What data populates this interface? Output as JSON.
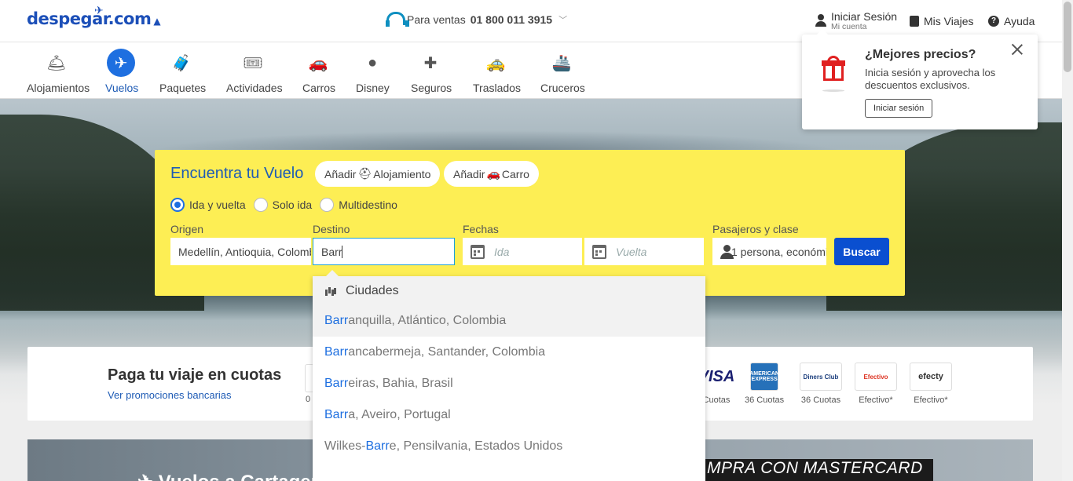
{
  "header": {
    "logo": "despegar.com",
    "sales_label": "Para ventas",
    "sales_phone": "01 800 011 3915",
    "login_main": "Iniciar Sesión",
    "login_sub": "Mi cuenta",
    "my_trips": "Mis Viajes",
    "help": "Ayuda"
  },
  "nav": {
    "items": [
      {
        "label": "Alojamientos",
        "icon": "hotel-bell-icon"
      },
      {
        "label": "Vuelos",
        "icon": "plane-icon",
        "active": true
      },
      {
        "label": "Paquetes",
        "icon": "suitcase-icon"
      },
      {
        "label": "Actividades",
        "icon": "tickets-icon"
      },
      {
        "label": "Carros",
        "icon": "car-icon"
      },
      {
        "label": "Disney",
        "icon": "mickey-icon"
      },
      {
        "label": "Seguros",
        "icon": "medkit-icon"
      },
      {
        "label": "Traslados",
        "icon": "taxi-icon"
      },
      {
        "label": "Cruceros",
        "icon": "ship-icon"
      }
    ]
  },
  "search": {
    "title": "Encuentra tu Vuelo",
    "add_lodging_pre": "Añadir",
    "add_lodging": "Alojamiento",
    "add_car_pre": "Añadir",
    "add_car": "Carro",
    "trip_types": [
      "Ida y vuelta",
      "Solo ida",
      "Multidestino"
    ],
    "selected_trip_type": "Ida y vuelta",
    "origin_label": "Origen",
    "origin_value": "Medellín, Antioquia, Colombia",
    "dest_label": "Destino",
    "dest_value": "Barr",
    "dates_label": "Fechas",
    "depart_placeholder": "Ida",
    "return_placeholder": "Vuelta",
    "pax_label": "Pasajeros y clase",
    "pax_value": "1 persona, económica",
    "search_button": "Buscar"
  },
  "autocomplete": {
    "group": "Ciudades",
    "items": [
      {
        "pre": "",
        "match": "Barr",
        "rest": "anquilla, Atlántico, Colombia"
      },
      {
        "pre": "",
        "match": "Barr",
        "rest": "ancabermeja, Santander, Colombia"
      },
      {
        "pre": "",
        "match": "Barr",
        "rest": "eiras, Bahia, Brasil"
      },
      {
        "pre": "",
        "match": "Barr",
        "rest": "a, Aveiro, Portugal"
      },
      {
        "pre": "Wilkes-",
        "match": "Barr",
        "rest": "e, Pensilvania, Estados Unidos"
      }
    ]
  },
  "payments": {
    "title": "Paga tu viaje en cuotas",
    "link": "Ver promociones bancarias",
    "first_caption": "0",
    "cards": [
      {
        "name": "VISA",
        "caption": "Cuotas"
      },
      {
        "name": "AMERICAN EXPRESS",
        "caption": "36 Cuotas"
      },
      {
        "name": "Diners Club",
        "caption": "36 Cuotas"
      },
      {
        "name": "Efectivo",
        "caption": "Efectivo*"
      },
      {
        "name": "efecty",
        "caption": "Efectivo*"
      }
    ]
  },
  "banner": {
    "left_text": "Vuelos a Cartagena",
    "right_text": "MPRA CON MASTERCARD"
  },
  "popover": {
    "title": "¿Mejores precios?",
    "desc": "Inicia sesión y aprovecha los descuentos exclusivos.",
    "button": "Iniciar sesión"
  },
  "colors": {
    "brand_blue": "#1e5bb5",
    "search_yellow": "#fdee54",
    "button_blue": "#0a4fd0",
    "gift_red": "#e02020"
  }
}
